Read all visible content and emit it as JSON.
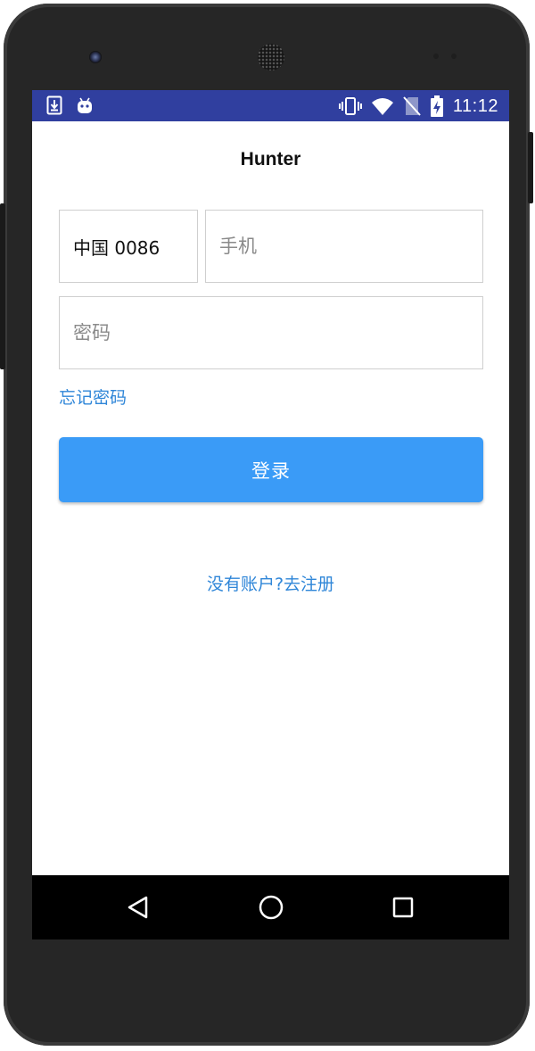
{
  "status_bar": {
    "time": "11:12",
    "background": "#303f9f",
    "left_icons": [
      "download-icon",
      "android-icon"
    ],
    "right_icons": [
      "vibrate-icon",
      "wifi-icon",
      "no-sim-icon",
      "battery-charging-icon"
    ]
  },
  "app": {
    "title": "Hunter"
  },
  "form": {
    "country_code": "中国 0086",
    "phone_placeholder": "手机",
    "password_placeholder": "密码",
    "forgot_password": "忘记密码",
    "login_label": "登录",
    "register_link": "没有账户?去注册"
  },
  "colors": {
    "accent": "#3a9bf7",
    "link": "#2f86d8"
  },
  "nav_bar": {
    "icons": [
      "back-icon",
      "home-icon",
      "recents-icon"
    ]
  }
}
